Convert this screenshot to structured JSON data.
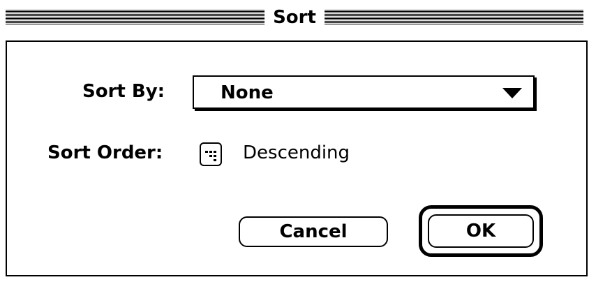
{
  "window": {
    "title": "Sort"
  },
  "sort_by": {
    "label": "Sort By:",
    "selected": "None",
    "arrow_icon": "triangle-down-icon"
  },
  "sort_order": {
    "label": "Sort Order:",
    "icon": "sort-order-toggle-icon",
    "value": "Descending"
  },
  "buttons": {
    "cancel_label": "Cancel",
    "ok_label": "OK"
  }
}
